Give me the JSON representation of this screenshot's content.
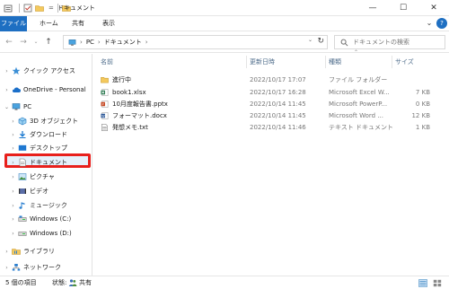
{
  "window": {
    "title": "ドキュメント",
    "minimize": "—",
    "maximize": "☐",
    "close": "✕"
  },
  "quick_access_toolbar": {
    "dropdown": "="
  },
  "ribbon": {
    "tabs": [
      "ファイル",
      "ホーム",
      "共有",
      "表示"
    ],
    "collapse": "⌄",
    "help": "?"
  },
  "address_bar": {
    "path": [
      "PC",
      "ドキュメント"
    ],
    "separator": "›",
    "search_placeholder": "ドキュメントの検索"
  },
  "nav_pane": {
    "items": [
      {
        "label": "クイック アクセス",
        "icon": "star-icon"
      },
      {
        "label": "OneDrive - Personal",
        "icon": "cloud-icon"
      },
      {
        "label": "PC",
        "icon": "pc-icon"
      },
      {
        "label": "3D オブジェクト",
        "icon": "cube-icon"
      },
      {
        "label": "ダウンロード",
        "icon": "download-icon"
      },
      {
        "label": "デスクトップ",
        "icon": "desktop-icon"
      },
      {
        "label": "ドキュメント",
        "icon": "document-icon"
      },
      {
        "label": "ピクチャ",
        "icon": "picture-icon"
      },
      {
        "label": "ビデオ",
        "icon": "video-icon"
      },
      {
        "label": "ミュージック",
        "icon": "music-icon"
      },
      {
        "label": "Windows (C:)",
        "icon": "drive-icon"
      },
      {
        "label": "Windows (D:)",
        "icon": "drive-icon"
      },
      {
        "label": "ライブラリ",
        "icon": "library-icon"
      },
      {
        "label": "ネットワーク",
        "icon": "network-icon"
      }
    ]
  },
  "file_list": {
    "columns": [
      "名前",
      "更新日時",
      "種類",
      "サイズ"
    ],
    "rows": [
      {
        "name": "進行中",
        "modified": "2022/10/17 17:07",
        "type": "ファイル フォルダー",
        "size": "",
        "icon": "folder-icon"
      },
      {
        "name": "book1.xlsx",
        "modified": "2022/10/17 16:28",
        "type": "Microsoft Excel W...",
        "size": "7 KB",
        "icon": "excel-file-icon"
      },
      {
        "name": "10月度報告書.pptx",
        "modified": "2022/10/14 11:45",
        "type": "Microsoft PowerP...",
        "size": "0 KB",
        "icon": "powerpoint-file-icon"
      },
      {
        "name": "フォーマット.docx",
        "modified": "2022/10/14 11:45",
        "type": "Microsoft Word ...",
        "size": "12 KB",
        "icon": "word-file-icon"
      },
      {
        "name": "発想メモ.txt",
        "modified": "2022/10/14 11:46",
        "type": "テキスト ドキュメント",
        "size": "1 KB",
        "icon": "text-file-icon"
      }
    ]
  },
  "status_bar": {
    "item_count": "5 個の項目",
    "state_label": "状態:",
    "state_value": "共有"
  },
  "colors": {
    "file_tab": "#1e6fc2",
    "selection_outline": "#e8201c",
    "selection_fill": "#e5f1fb"
  }
}
